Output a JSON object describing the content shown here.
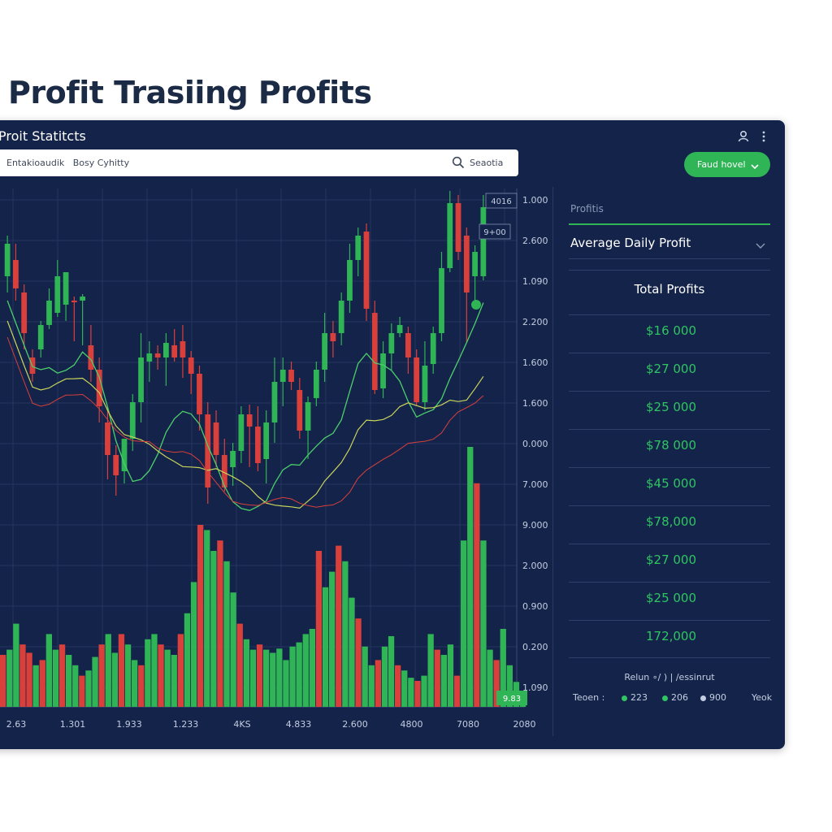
{
  "page": {
    "title": "Profit Trasiing Profits"
  },
  "panel": {
    "title": "Proit Statitcts",
    "header_icons": [
      "user-icon",
      "more-vertical-icon"
    ],
    "search": {
      "value": "Entakioaudik   Bosy Cyhitty",
      "button_label": "Seaotia"
    },
    "action_button": {
      "label": "Faud hovel"
    }
  },
  "chart_data": {
    "type": "candlestick",
    "y_tick_labels": [
      "1.000",
      "2.600",
      "1.090",
      "2.200",
      "1.600",
      "1.600",
      "0.000",
      "7.000",
      "9.000",
      "2.000",
      "0.900",
      "0.200",
      "1.090"
    ],
    "x_tick_labels": [
      "2.63",
      "1.301",
      "1.933",
      "1.233",
      "4KS",
      "4.833",
      "2.600",
      "4800",
      "7080",
      "2080"
    ],
    "badges": [
      "4016",
      "9+00",
      "9.83"
    ],
    "colors": {
      "up": "#2fb456",
      "down": "#d9403c",
      "grid": "#243560",
      "ma_fast": "#4ccf6b",
      "ma_mid": "#c9d45a",
      "ma_slow": "#d9403c"
    },
    "candles": [
      {
        "o": 340,
        "c": 300,
        "h": 290,
        "l": 360
      },
      {
        "o": 320,
        "c": 355,
        "h": 300,
        "l": 370
      },
      {
        "o": 360,
        "c": 410,
        "h": 350,
        "l": 430
      },
      {
        "o": 440,
        "c": 460,
        "h": 430,
        "l": 470
      },
      {
        "o": 430,
        "c": 400,
        "h": 395,
        "l": 440
      },
      {
        "o": 400,
        "c": 370,
        "h": 355,
        "l": 405
      },
      {
        "o": 385,
        "c": 340,
        "h": 320,
        "l": 390
      },
      {
        "o": 375,
        "c": 335,
        "h": 355,
        "l": 395
      },
      {
        "o": 370,
        "c": 370,
        "h": 365,
        "l": 420
      },
      {
        "o": 370,
        "c": 365,
        "h": 362,
        "l": 425
      },
      {
        "o": 425,
        "c": 455,
        "h": 400,
        "l": 470
      },
      {
        "o": 455,
        "c": 500,
        "h": 440,
        "l": 520
      },
      {
        "o": 520,
        "c": 560,
        "h": 500,
        "l": 590
      },
      {
        "o": 560,
        "c": 585,
        "h": 548,
        "l": 610
      },
      {
        "o": 580,
        "c": 540,
        "h": 545,
        "l": 595
      },
      {
        "o": 540,
        "c": 495,
        "h": 485,
        "l": 555
      },
      {
        "o": 495,
        "c": 440,
        "h": 410,
        "l": 520
      },
      {
        "o": 445,
        "c": 435,
        "h": 420,
        "l": 470
      },
      {
        "o": 435,
        "c": 440,
        "h": 425,
        "l": 455
      },
      {
        "o": 440,
        "c": 422,
        "h": 410,
        "l": 475
      },
      {
        "o": 425,
        "c": 440,
        "h": 405,
        "l": 445
      },
      {
        "o": 420,
        "c": 440,
        "h": 400,
        "l": 465
      },
      {
        "o": 440,
        "c": 460,
        "h": 432,
        "l": 485
      },
      {
        "o": 460,
        "c": 510,
        "h": 450,
        "l": 530
      },
      {
        "o": 510,
        "c": 600,
        "h": 495,
        "l": 620
      },
      {
        "o": 520,
        "c": 560,
        "h": 505,
        "l": 575
      },
      {
        "o": 560,
        "c": 600,
        "h": 540,
        "l": 605
      },
      {
        "o": 575,
        "c": 555,
        "h": 545,
        "l": 598
      },
      {
        "o": 555,
        "c": 510,
        "h": 500,
        "l": 570
      },
      {
        "o": 510,
        "c": 525,
        "h": 498,
        "l": 575
      },
      {
        "o": 525,
        "c": 570,
        "h": 500,
        "l": 580
      },
      {
        "o": 565,
        "c": 520,
        "h": 505,
        "l": 595
      },
      {
        "o": 520,
        "c": 470,
        "h": 440,
        "l": 545
      },
      {
        "o": 470,
        "c": 455,
        "h": 440,
        "l": 500
      },
      {
        "o": 455,
        "c": 470,
        "h": 445,
        "l": 480
      },
      {
        "o": 480,
        "c": 530,
        "h": 465,
        "l": 540
      },
      {
        "o": 530,
        "c": 495,
        "h": 488,
        "l": 565
      },
      {
        "o": 490,
        "c": 455,
        "h": 445,
        "l": 500
      },
      {
        "o": 455,
        "c": 410,
        "h": 385,
        "l": 470
      },
      {
        "o": 410,
        "c": 420,
        "h": 395,
        "l": 440
      },
      {
        "o": 410,
        "c": 370,
        "h": 360,
        "l": 425
      },
      {
        "o": 370,
        "c": 320,
        "h": 300,
        "l": 385
      },
      {
        "o": 320,
        "c": 290,
        "h": 280,
        "l": 340
      },
      {
        "o": 285,
        "c": 380,
        "h": 275,
        "l": 395
      },
      {
        "o": 385,
        "c": 480,
        "h": 370,
        "l": 485
      },
      {
        "o": 478,
        "c": 435,
        "h": 420,
        "l": 490
      },
      {
        "o": 435,
        "c": 410,
        "h": 398,
        "l": 455
      },
      {
        "o": 410,
        "c": 400,
        "h": 390,
        "l": 415
      },
      {
        "o": 410,
        "c": 440,
        "h": 402,
        "l": 460
      },
      {
        "o": 440,
        "c": 495,
        "h": 430,
        "l": 500
      },
      {
        "o": 495,
        "c": 450,
        "h": 420,
        "l": 505
      },
      {
        "o": 448,
        "c": 410,
        "h": 402,
        "l": 460
      },
      {
        "o": 410,
        "c": 330,
        "h": 310,
        "l": 420
      },
      {
        "o": 330,
        "c": 250,
        "h": 235,
        "l": 335
      },
      {
        "o": 250,
        "c": 310,
        "h": 240,
        "l": 320
      },
      {
        "o": 290,
        "c": 360,
        "h": 280,
        "l": 422
      },
      {
        "o": 340,
        "c": 310,
        "h": 302,
        "l": 375
      },
      {
        "o": 340,
        "c": 255,
        "h": 240,
        "l": 345
      }
    ],
    "volumes": [
      50,
      55,
      80,
      60,
      52,
      40,
      45,
      70,
      55,
      60,
      50,
      40,
      30,
      35,
      48,
      60,
      70,
      52,
      70,
      60,
      45,
      40,
      65,
      70,
      60,
      55,
      50,
      70,
      90,
      120,
      175,
      170,
      150,
      160,
      140,
      110,
      80,
      65,
      55,
      60,
      55,
      52,
      56,
      45,
      58,
      62,
      70,
      75,
      150,
      115,
      130,
      155,
      140,
      105,
      85,
      58,
      40,
      45,
      58,
      68,
      40,
      35,
      28,
      25,
      30,
      70,
      55,
      50,
      60,
      30,
      160,
      250,
      215,
      160,
      55,
      45,
      75,
      40,
      24,
      14
    ]
  },
  "right_panel": {
    "small_label": "Profitis",
    "dropdown_label": "Average Daily Profit",
    "header": "Total Profits",
    "values": [
      "$16 000",
      "$27 000",
      "$25 000",
      "$78 000",
      "$45 000",
      "$78,000",
      "$27 000",
      "$25 000",
      "172,000"
    ],
    "footer_title": "Relun ∘∕ ) | ∕essinrut",
    "footer_label": "Teoen :",
    "footer_items": [
      "223",
      "206",
      "900"
    ],
    "footer_tail": "Yeok"
  }
}
